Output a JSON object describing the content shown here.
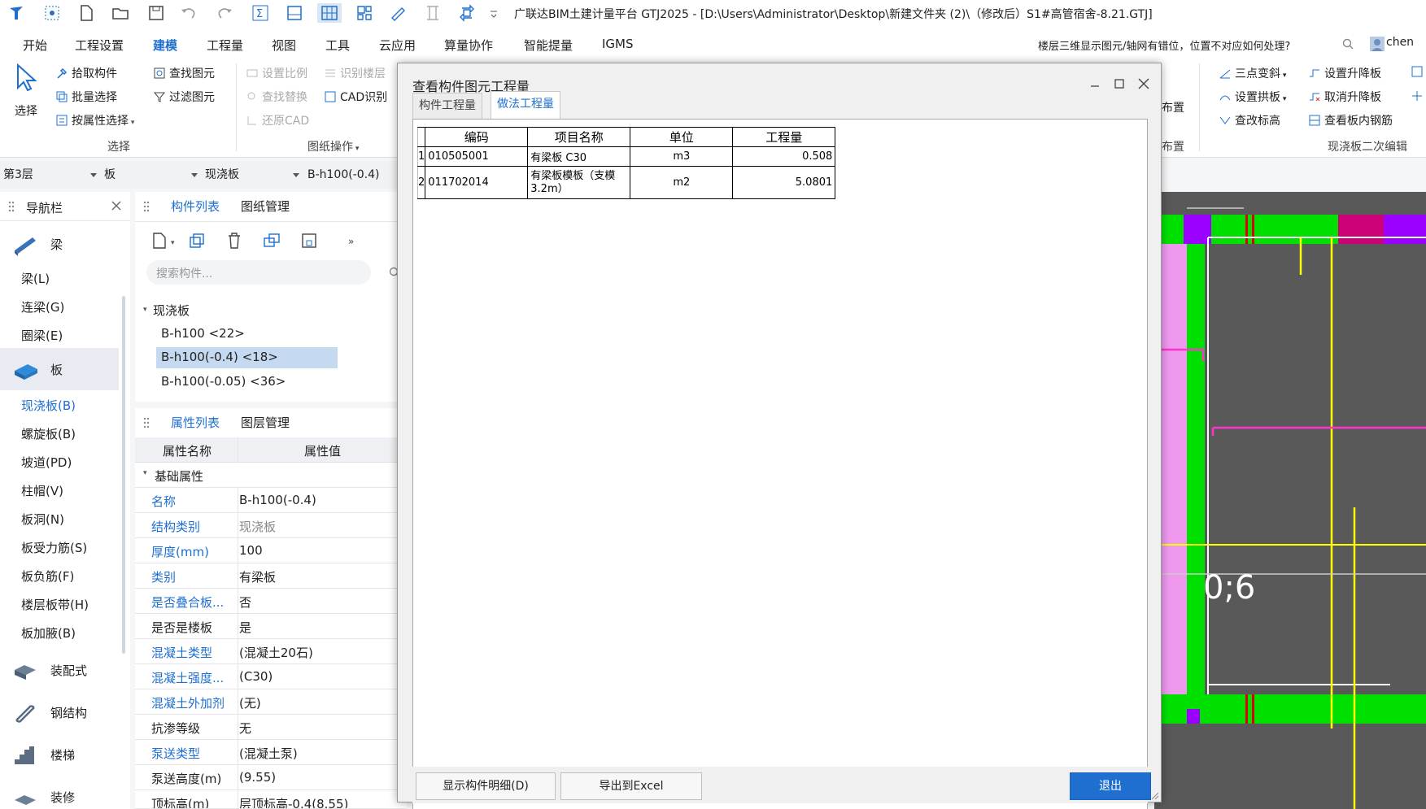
{
  "app": {
    "title": "广联达BIM土建计量平台 GTJ2025 - [D:\\Users\\Administrator\\Desktop\\新建文件夹 (2)\\（修改后）S1#高管宿舍-8.21.GTJ]"
  },
  "menu": {
    "items": [
      "开始",
      "工程设置",
      "建模",
      "工程量",
      "视图",
      "工具",
      "云应用",
      "算量协作",
      "智能提量",
      "IGMS"
    ],
    "active": "建模",
    "help_question": "楼层三维显示图元/轴网有错位，位置不对应如何处理?",
    "user": "chen"
  },
  "ribbon": {
    "select_group": {
      "select_label": "选择",
      "pick_component": "拾取构件",
      "batch_select": "批量选择",
      "select_by_attr": "按属性选择",
      "find_element": "查找图元",
      "filter_element": "过滤图元",
      "group_label": "选择"
    },
    "drawing_group": {
      "set_scale": "设置比例",
      "identify_floor": "识别楼层",
      "find_replace": "查找替换",
      "cad_identify": "CAD识别",
      "restore_cad": "还原CAD",
      "group_label": "图纸操作"
    },
    "slab_edit_group": {
      "three_point_slope": "三点变斜",
      "set_raise": "设置升降板",
      "set_arch": "设置拱板",
      "cancel_raise": "取消升降板",
      "check_elevation": "查改标高",
      "view_rebar": "查看板内钢筋",
      "group_label": "现浇板二次编辑"
    },
    "partial_label_1": "布置",
    "partial_label_2": "布置"
  },
  "selectors": {
    "floor": "第3层",
    "category": "板",
    "type": "现浇板",
    "component": "B-h100(-0.4)"
  },
  "nav": {
    "title": "导航栏",
    "categories": [
      {
        "label": "梁"
      },
      {
        "label": "板"
      },
      {
        "label": "装配式"
      },
      {
        "label": "钢结构"
      },
      {
        "label": "楼梯"
      },
      {
        "label": "装修"
      }
    ],
    "beam_items": [
      "梁(L)",
      "连梁(G)",
      "圈梁(E)"
    ],
    "slab_items": [
      "现浇板(B)",
      "螺旋板(B)",
      "坡道(PD)",
      "柱帽(V)",
      "板洞(N)",
      "板受力筋(S)",
      "板负筋(F)",
      "楼层板带(H)",
      "板加腋(B)"
    ]
  },
  "component_panel": {
    "tabs": [
      "构件列表",
      "图纸管理"
    ],
    "search_placeholder": "搜索构件...",
    "tree_root": "现浇板",
    "items": [
      "B-h100 <22>",
      "B-h100(-0.4) <18>",
      "B-h100(-0.05) <36>"
    ],
    "selected_index": 1
  },
  "property_panel": {
    "tabs": [
      "属性列表",
      "图层管理"
    ],
    "col_name": "属性名称",
    "col_value": "属性值",
    "section": "基础属性",
    "rows": [
      {
        "name": "名称",
        "value": "B-h100(-0.4)"
      },
      {
        "name": "结构类别",
        "value": "现浇板"
      },
      {
        "name": "厚度(mm)",
        "value": "100"
      },
      {
        "name": "类别",
        "value": "有梁板"
      },
      {
        "name": "是否叠合板...",
        "value": "否"
      },
      {
        "name": "是否是楼板",
        "value": "是"
      },
      {
        "name": "混凝土类型",
        "value": "(混凝土20石)"
      },
      {
        "name": "混凝土强度...",
        "value": "(C30)"
      },
      {
        "name": "混凝土外加剂",
        "value": "(无)"
      },
      {
        "name": "抗渗等级",
        "value": "无"
      },
      {
        "name": "泵送类型",
        "value": "(混凝土泵)"
      },
      {
        "name": "泵送高度(m)",
        "value": "(9.55)"
      },
      {
        "name": "顶标高(m)",
        "value": "层顶标高-0.4(8.55)"
      }
    ]
  },
  "canvas": {
    "label": "0;6"
  },
  "dialog": {
    "title": "查看构件图元工程量",
    "tabs": [
      "构件工程量",
      "做法工程量"
    ],
    "active_tab": "做法工程量",
    "table": {
      "headers": [
        "编码",
        "项目名称",
        "单位",
        "工程量"
      ],
      "rows": [
        {
          "no": "1",
          "code": "010505001",
          "name": "有梁板 C30",
          "unit": "m3",
          "qty": "0.508"
        },
        {
          "no": "2",
          "code": "011702014",
          "name": "有梁板模板（支模3.2m）",
          "unit": "m2",
          "qty": "5.0801"
        }
      ]
    },
    "buttons": {
      "show_detail": "显示构件明细(D)",
      "export_excel": "导出到Excel",
      "exit": "退出"
    }
  }
}
